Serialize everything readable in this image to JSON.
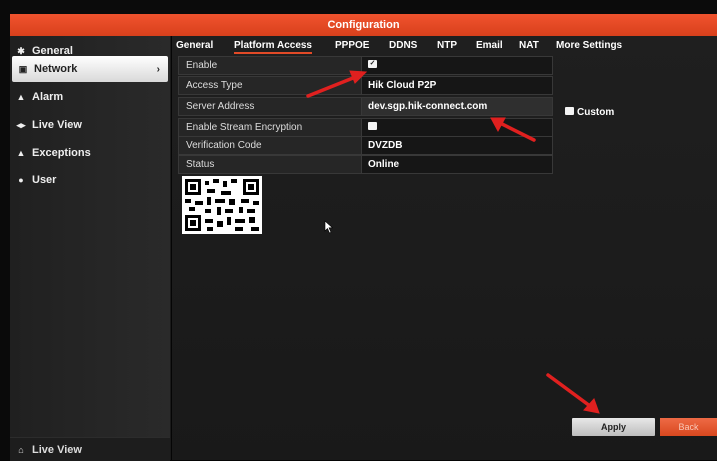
{
  "window": {
    "title": "Configuration"
  },
  "sidebar": {
    "items": [
      {
        "label": "General",
        "icon": "gear-icon"
      },
      {
        "label": "Network",
        "icon": "network-icon",
        "active": true
      },
      {
        "label": "Alarm",
        "icon": "alarm-icon"
      },
      {
        "label": "Live View",
        "icon": "live-view-icon"
      },
      {
        "label": "Exceptions",
        "icon": "warning-icon"
      },
      {
        "label": "User",
        "icon": "user-icon"
      }
    ],
    "bottom_label": "Live View"
  },
  "tabs": [
    {
      "label": "General"
    },
    {
      "label": "Platform Access",
      "active": true
    },
    {
      "label": "PPPOE"
    },
    {
      "label": "DDNS"
    },
    {
      "label": "NTP"
    },
    {
      "label": "Email"
    },
    {
      "label": "NAT"
    },
    {
      "label": "More Settings"
    }
  ],
  "form": {
    "enable_label": "Enable",
    "enable_checked": true,
    "access_type_label": "Access Type",
    "access_type_value": "Hik Cloud P2P",
    "server_address_label": "Server Address",
    "server_address_value": "dev.sgp.hik-connect.com",
    "custom_label": "Custom",
    "custom_checked": false,
    "stream_encryption_label": "Enable Stream Encryption",
    "stream_encryption_checked": false,
    "verification_code_label": "Verification Code",
    "verification_code_value": "DVZDB",
    "status_label": "Status",
    "status_value": "Online"
  },
  "buttons": {
    "apply_label": "Apply",
    "back_label": "Back"
  },
  "colors": {
    "accent": "#e24a27",
    "annotation_arrow": "#e0201f"
  }
}
